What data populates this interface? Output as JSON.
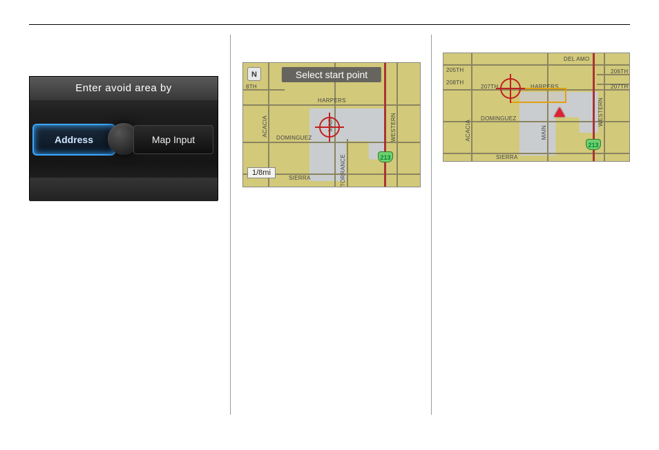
{
  "device": {
    "title": "Enter avoid area by",
    "options": {
      "left": "Address",
      "right": "Map Input"
    }
  },
  "map1": {
    "header": "Select start point",
    "north": "N",
    "scale": "1/8mi",
    "highway_shield": "213",
    "labels": {
      "harpers": "HARPERS",
      "dominguez": "DOMINGUEZ",
      "sierra": "SIERRA",
      "torrance": "TORRANCE",
      "main": "MAIN",
      "acacia": "ACACIA",
      "western": "WESTERN",
      "eighth": "8TH"
    }
  },
  "map2": {
    "highway_shield": "213",
    "labels": {
      "del_amo": "DEL AMO",
      "harpers": "HARPERS",
      "dominguez": "DOMINGUEZ",
      "sierra": "SIERRA",
      "main": "MAIN",
      "acacia": "ACACIA",
      "western": "WESTERN",
      "s205th": "205TH",
      "s206th": "206TH",
      "s207th_l": "207TH",
      "s207th_r": "207TH",
      "s208th": "208TH"
    }
  }
}
